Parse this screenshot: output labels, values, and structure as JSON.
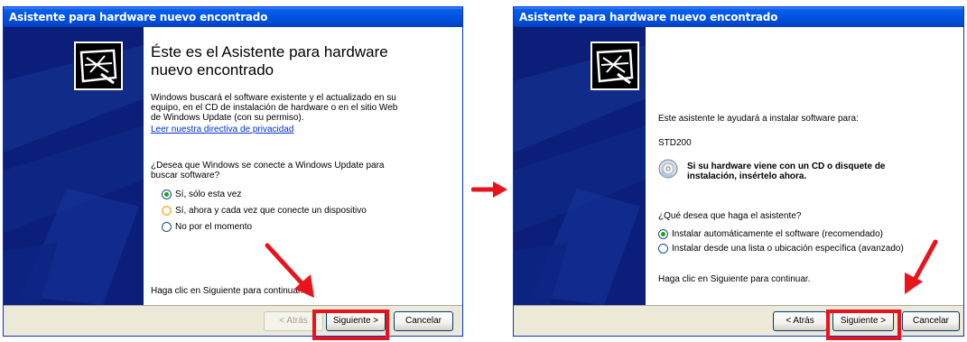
{
  "left_window": {
    "title": "Asistente para hardware nuevo encontrado",
    "heading_line1": "Éste es el Asistente para hardware",
    "heading_line2": "nuevo encontrado",
    "intro_line1": "Windows buscará el software existente y el actualizado en su",
    "intro_line2": "equipo, en el CD de instalación de hardware o en el sitio Web",
    "intro_line3": "de Windows Update (con su permiso).",
    "privacy_link": "Leer nuestra directiva de privacidad",
    "question_line1": "¿Desea que Windows se conecte a Windows Update para",
    "question_line2": "buscar software?",
    "options": [
      "Sí, sólo esta vez",
      "Sí, ahora y cada vez que conecte un dispositivo",
      "No por el momento"
    ],
    "selected_option": 0,
    "continue_text": "Haga clic en Siguiente para continuar.",
    "back_label": "< Atrás",
    "next_label": "Siguiente >",
    "cancel_label": "Cancelar"
  },
  "right_window": {
    "title": "Asistente para hardware nuevo encontrado",
    "intro": "Este asistente le ayudará a instalar software para:",
    "device_name": "STD200",
    "cd_line1": "Si su hardware viene con un CD o disquete de",
    "cd_line2": "instalación, insértelo ahora.",
    "question": "¿Qué desea que haga el asistente?",
    "options": [
      "Instalar automáticamente el software (recomendado)",
      "Instalar desde una lista o ubicación específica (avanzado)"
    ],
    "selected_option": 0,
    "continue_text": "Haga clic en Siguiente para continuar.",
    "back_label": "< Atrás",
    "next_label": "Siguiente >",
    "cancel_label": "Cancelar"
  },
  "colors": {
    "titlebar": "#0054e3",
    "highlight": "#e8141c",
    "side_panel": "#0b1e7a"
  },
  "icons": [
    "hardware-wizard-icon",
    "cd-icon",
    "red-arrow"
  ]
}
